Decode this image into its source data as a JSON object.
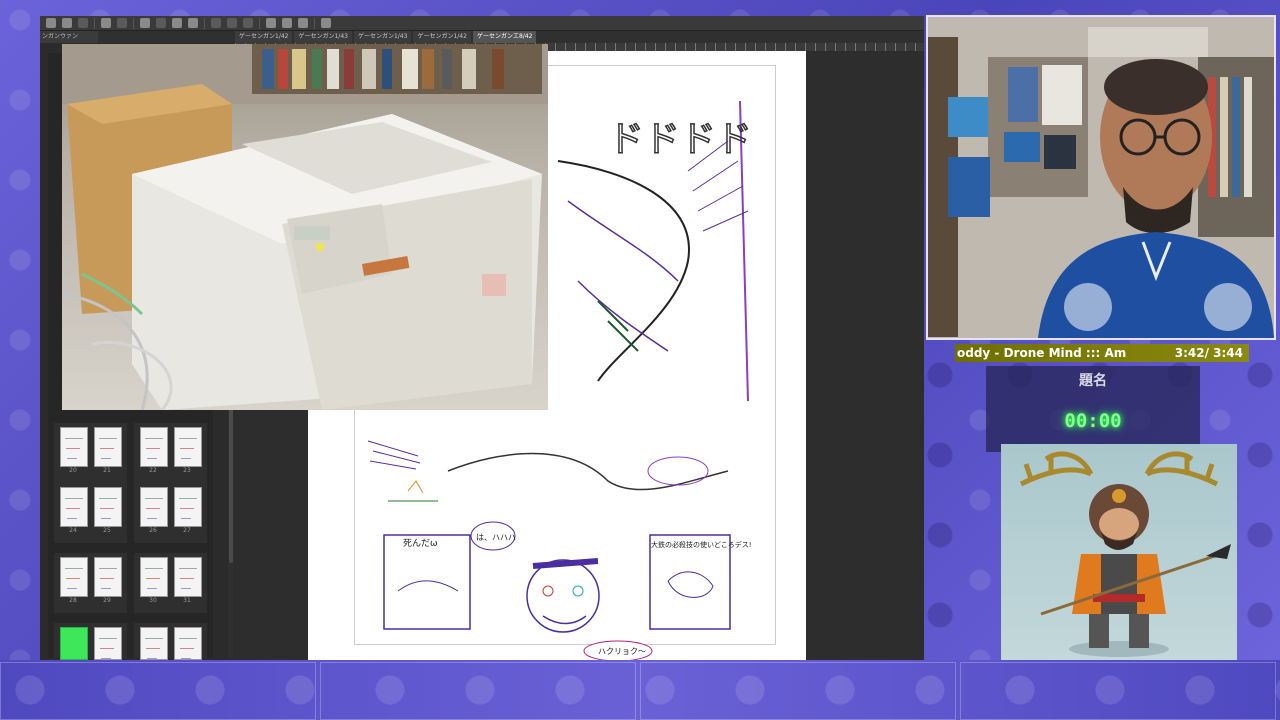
{
  "app": {
    "left_panel_tab": "ンガンウァン",
    "tabs": [
      {
        "label": "ゲーセンガン1/42",
        "active": false
      },
      {
        "label": "ゲーセンガン1/43",
        "active": false
      },
      {
        "label": "ゲーセンガン1/43",
        "active": false
      },
      {
        "label": "ゲーセンガン1/42",
        "active": false
      },
      {
        "label": "ゲーセンガンエ8/42",
        "active": true
      }
    ]
  },
  "page_browser": {
    "rows": [
      {
        "numbers": [
          "20",
          "21",
          "22",
          "23"
        ]
      },
      {
        "numbers": [
          "24",
          "25",
          "26",
          "27"
        ]
      },
      {
        "numbers": [
          "28",
          "29",
          "30",
          "31"
        ]
      },
      {
        "numbers": [
          "",
          "",
          "",
          ""
        ]
      }
    ]
  },
  "manga_page": {
    "sfx": "ドドドド",
    "balloon_1": "死んだω",
    "balloon_2": "は、ハハハ",
    "balloon_3": "大鉄の必殺技の使いどころデス!",
    "caption": "ハクリョク〜"
  },
  "now_playing": {
    "track": "oddy - Drone Mind  :::  Am",
    "time": "3:42/ 3:44"
  },
  "timer": {
    "title": "題名",
    "value": "00:00"
  },
  "colors": {
    "overlay_bg": "#5a56c8",
    "timer_text": "#7dff8a",
    "now_playing_bg": "#7d7d00",
    "selected_page": "#3ee65a"
  }
}
